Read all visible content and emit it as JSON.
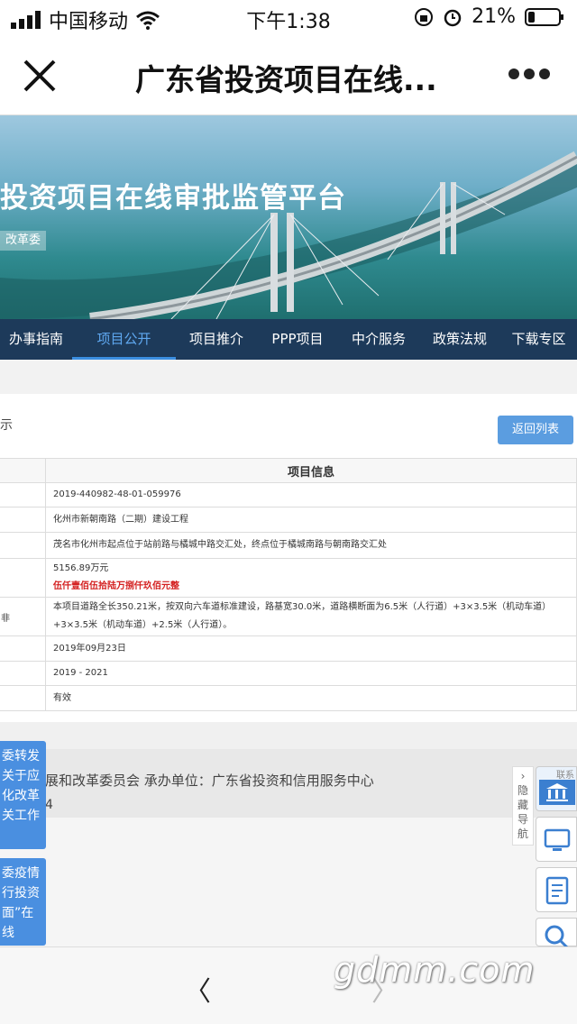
{
  "status": {
    "carrier": "中国移动",
    "time": "下午1:38",
    "battery": "21%"
  },
  "nav": {
    "title": "广东省投资项目在线..."
  },
  "banner": {
    "headline": "投资项目在线审批监管平台",
    "tag": "改革委"
  },
  "menu": {
    "items": [
      "办事指南",
      "项目公开",
      "项目推介",
      "PPP项目",
      "中介服务",
      "政策法规",
      "下载专区"
    ],
    "active_index": 1
  },
  "panel": {
    "crumb": "示",
    "back_label": "返回列表",
    "table_title": "项目信息",
    "rows": [
      {
        "key": "",
        "value": "2019-440982-48-01-059976"
      },
      {
        "key": "",
        "value": "化州市新朝南路（二期）建设工程"
      },
      {
        "key": "",
        "value": "茂名市化州市起点位于站前路与橘城中路交汇处，终点位于橘城南路与朝南路交汇处"
      },
      {
        "key": "",
        "value": "5156.89万元",
        "value_red": "伍仟壹佰伍拾陆万捌仟玖佰元整"
      },
      {
        "key": "非",
        "value": "本项目道路全长350.21米，按双向六车道标准建设，路基宽30.0米，道路横断面为6.5米（人行道）+3×3.5米（机动车道）+3×3.5米（机动车道）+2.5米（人行道）。"
      },
      {
        "key": "",
        "value": "2019年09月23日"
      },
      {
        "key": "",
        "value": "2019 - 2021"
      },
      {
        "key": "",
        "value": "有效"
      }
    ]
  },
  "footer": {
    "line1": "展和改革委员会   承办单位：广东省投资和信用服务中心",
    "line2": "4"
  },
  "notices": [
    {
      "text": "委转发 关于应 化改革 关工作"
    },
    {
      "text": "委疫情 行投资 面”在线"
    }
  ],
  "hide_nav": {
    "label": "隐藏导航"
  },
  "side": {
    "top_label": "联系"
  },
  "watermark": "gdmm.com",
  "colors": {
    "menu_bg": "#1d3a5a",
    "accent": "#5b9de0",
    "red": "#d42020"
  }
}
